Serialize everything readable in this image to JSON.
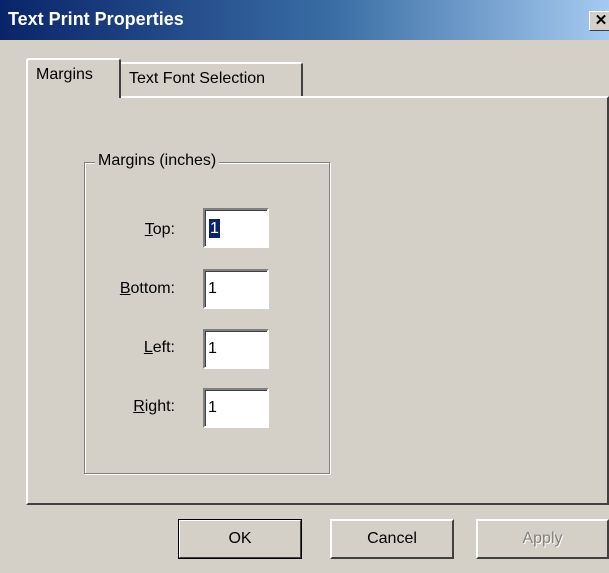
{
  "window": {
    "title": "Text Print Properties",
    "close_glyph": "✕"
  },
  "tabs": [
    {
      "label": "Margins",
      "active": true
    },
    {
      "label": "Text Font Selection",
      "active": false
    }
  ],
  "group": {
    "label": "Margins (inches)"
  },
  "fields": {
    "top": {
      "label_mnemonic": "T",
      "label_rest": "op:",
      "value": "1",
      "selected": true
    },
    "bottom": {
      "label_mnemonic": "B",
      "label_rest": "ottom:",
      "value": "1"
    },
    "left": {
      "label_mnemonic": "L",
      "label_rest": "eft:",
      "value": "1"
    },
    "right": {
      "label_mnemonic": "R",
      "label_rest": "ight:",
      "value": "1"
    }
  },
  "buttons": {
    "ok": "OK",
    "cancel": "Cancel",
    "apply": "Apply",
    "apply_enabled": false
  },
  "colors": {
    "title_bar_start": "#0a246a",
    "title_bar_end": "#a6caf0",
    "face": "#d4d0c8",
    "selection": "#0a246a"
  }
}
